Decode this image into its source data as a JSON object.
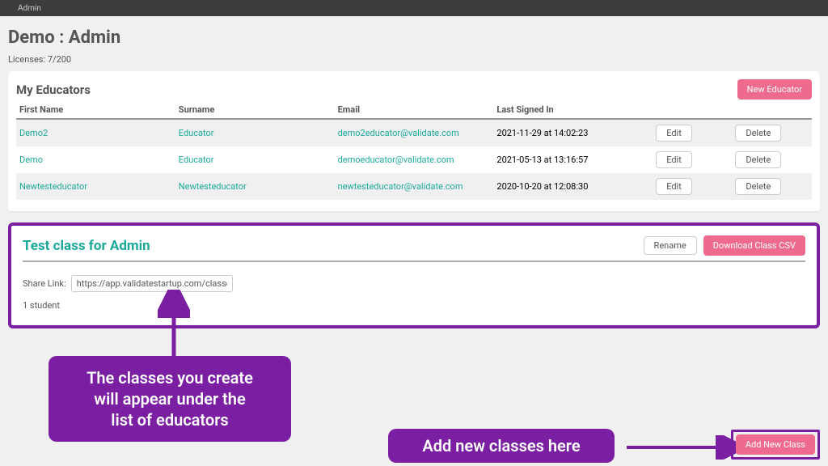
{
  "topnav": {
    "admin": "Admin"
  },
  "page": {
    "title": "Demo : Admin",
    "licenses": "Licenses: 7/200"
  },
  "educators": {
    "title": "My Educators",
    "new_btn": "New Educator",
    "headers": {
      "first": "First Name",
      "surname": "Surname",
      "email": "Email",
      "last": "Last Signed In"
    },
    "edit_label": "Edit",
    "delete_label": "Delete",
    "rows": [
      {
        "first": "Demo2",
        "surname": "Educator",
        "email": "demo2educator@validate.com",
        "last": "2021-11-29 at 14:02:23"
      },
      {
        "first": "Demo",
        "surname": "Educator",
        "email": "demoeducator@validate.com",
        "last": "2021-05-13 at 13:16:57"
      },
      {
        "first": "Newtesteducator",
        "surname": "Newtesteducator",
        "email": "newtesteducator@validate.com",
        "last": "2020-10-20 at 12:08:30"
      }
    ]
  },
  "class_card": {
    "title": "Test class for Admin",
    "rename_btn": "Rename",
    "download_btn": "Download Class CSV",
    "share_label": "Share Link:",
    "share_url": "https://app.validatestartup.com/classes/share/Fn",
    "student_count": "1 student"
  },
  "add_new_class": {
    "label": "Add New Class"
  },
  "annot": {
    "a1_l1": "The classes you create",
    "a1_l2": "will appear under the",
    "a1_l3": "list of educators",
    "a2": "Add new classes here"
  }
}
